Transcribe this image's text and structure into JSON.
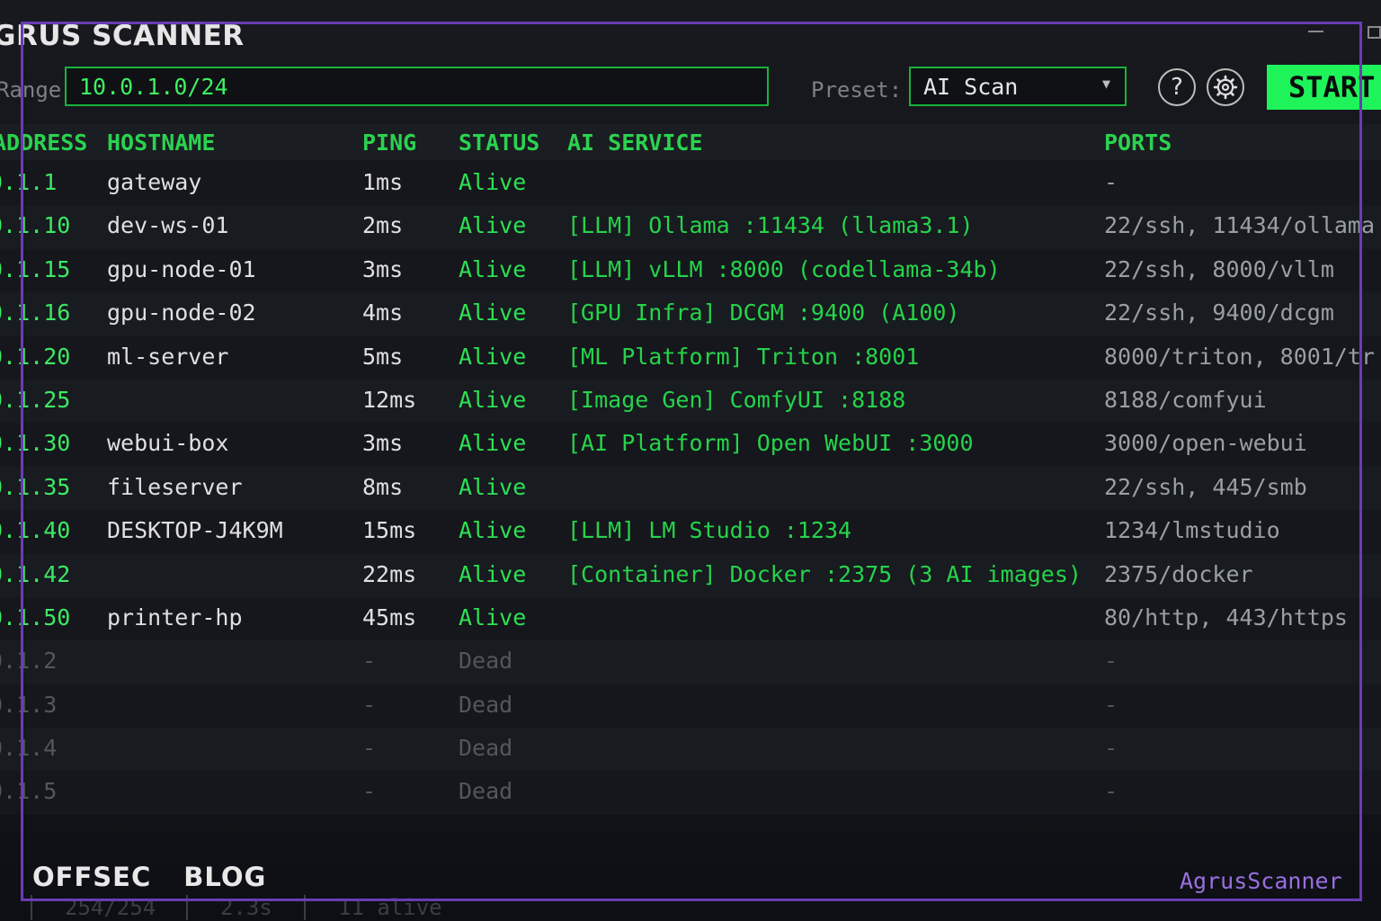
{
  "app": {
    "title": "GRUS SCANNER"
  },
  "toolbar": {
    "range_label": "Range",
    "range_value": "10.0.1.0/24",
    "preset_label": "Preset:",
    "preset_value": "AI Scan",
    "help_label": "?",
    "settings_icon": "gear-icon",
    "start_label": "START"
  },
  "table": {
    "headers": {
      "ip": "ADDRESS",
      "host": "HOSTNAME",
      "ping": "PING",
      "status": "STATUS",
      "ai": "AI SERVICE",
      "ports": "PORTS"
    },
    "rows": [
      {
        "ip": "0.1.1",
        "host": "gateway",
        "ping": "1ms",
        "status": "Alive",
        "ai": "",
        "ports": "-"
      },
      {
        "ip": "0.1.10",
        "host": "dev-ws-01",
        "ping": "2ms",
        "status": "Alive",
        "ai": "[LLM] Ollama :11434 (llama3.1)",
        "ports": "22/ssh, 11434/ollama"
      },
      {
        "ip": "0.1.15",
        "host": "gpu-node-01",
        "ping": "3ms",
        "status": "Alive",
        "ai": "[LLM] vLLM :8000 (codellama-34b)",
        "ports": "22/ssh, 8000/vllm"
      },
      {
        "ip": "0.1.16",
        "host": "gpu-node-02",
        "ping": "4ms",
        "status": "Alive",
        "ai": "[GPU Infra] DCGM :9400 (A100)",
        "ports": "22/ssh, 9400/dcgm"
      },
      {
        "ip": "0.1.20",
        "host": "ml-server",
        "ping": "5ms",
        "status": "Alive",
        "ai": "[ML Platform] Triton :8001",
        "ports": "8000/triton, 8001/tr"
      },
      {
        "ip": "0.1.25",
        "host": "",
        "ping": "12ms",
        "status": "Alive",
        "ai": "[Image Gen] ComfyUI :8188",
        "ports": "8188/comfyui"
      },
      {
        "ip": "0.1.30",
        "host": "webui-box",
        "ping": "3ms",
        "status": "Alive",
        "ai": "[AI Platform] Open WebUI :3000",
        "ports": "3000/open-webui"
      },
      {
        "ip": "0.1.35",
        "host": "fileserver",
        "ping": "8ms",
        "status": "Alive",
        "ai": "",
        "ports": "22/ssh, 445/smb"
      },
      {
        "ip": "0.1.40",
        "host": "DESKTOP-J4K9M",
        "ping": "15ms",
        "status": "Alive",
        "ai": "[LLM] LM Studio :1234",
        "ports": "1234/lmstudio"
      },
      {
        "ip": "0.1.42",
        "host": "",
        "ping": "22ms",
        "status": "Alive",
        "ai": "[Container] Docker :2375 (3 AI images)",
        "ports": "2375/docker"
      },
      {
        "ip": "0.1.50",
        "host": "printer-hp",
        "ping": "45ms",
        "status": "Alive",
        "ai": "",
        "ports": "80/http, 443/https"
      },
      {
        "ip": "0.1.2",
        "host": "",
        "ping": "-",
        "status": "Dead",
        "ai": "",
        "ports": "-"
      },
      {
        "ip": "0.1.3",
        "host": "",
        "ping": "-",
        "status": "Dead",
        "ai": "",
        "ports": "-"
      },
      {
        "ip": "0.1.4",
        "host": "",
        "ping": "-",
        "status": "Dead",
        "ai": "",
        "ports": "-"
      },
      {
        "ip": "0.1.5",
        "host": "",
        "ping": "-",
        "status": "Dead",
        "ai": "",
        "ports": "-"
      }
    ]
  },
  "statusbar": {
    "progress": "254/254",
    "elapsed": "2.3s",
    "alive": "11 alive"
  },
  "overlay": {
    "brand_left": "OFFSEC",
    "brand_right": "BLOG",
    "watermark": "AgrusScanner"
  },
  "colors": {
    "accent": "#1ef45a",
    "frame": "#6a3cb4",
    "watermark": "#9b6ee0"
  }
}
